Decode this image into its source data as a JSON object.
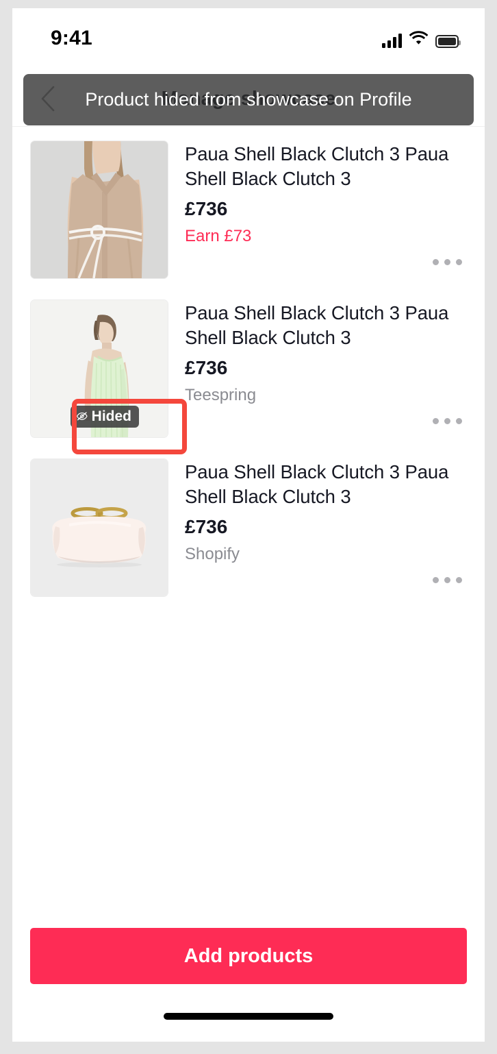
{
  "status_bar": {
    "time": "9:41",
    "cellular_icon": "cellular-signal-icon",
    "wifi_icon": "wifi-icon",
    "battery_icon": "battery-full-icon"
  },
  "header": {
    "title": "Manage showcase",
    "back_icon": "back-chevron-icon"
  },
  "toast": {
    "message": "Product hided from showcase on Profile",
    "background_color": "#303030",
    "text_color": "#ffffff"
  },
  "annotation": {
    "color": "#f4473c",
    "target": "hided-badge"
  },
  "products": [
    {
      "title": "Paua Shell Black Clutch 3 Paua Shell Black Clutch 3",
      "price": "£736",
      "subtitle": "Earn £73",
      "subtitle_kind": "earn",
      "hidden": false,
      "image_alt": "beige sleeveless shirt dress with white rope belt",
      "more_icon": "more-options-icon"
    },
    {
      "title": "Paua Shell Black Clutch 3 Paua Shell Black Clutch 3",
      "price": "£736",
      "subtitle": "Teespring",
      "subtitle_kind": "merchant",
      "hidden": true,
      "hidden_badge_label": "Hided",
      "hidden_badge_icon": "eye-slash-icon",
      "image_alt": "model wearing mint green ribbed sleeveless dress",
      "more_icon": "more-options-icon"
    },
    {
      "title": "Paua Shell Black Clutch 3 Paua Shell Black Clutch 3",
      "price": "£736",
      "subtitle": "Shopify",
      "subtitle_kind": "merchant",
      "hidden": false,
      "image_alt": "cream pouch clutch bag with gold ring clasps",
      "more_icon": "more-options-icon"
    }
  ],
  "cta": {
    "label": "Add products",
    "color": "#fe2c55"
  },
  "colors": {
    "accent": "#fe2c55",
    "text_primary": "#161823",
    "text_secondary": "#8a8b91",
    "annotation": "#f4473c"
  }
}
